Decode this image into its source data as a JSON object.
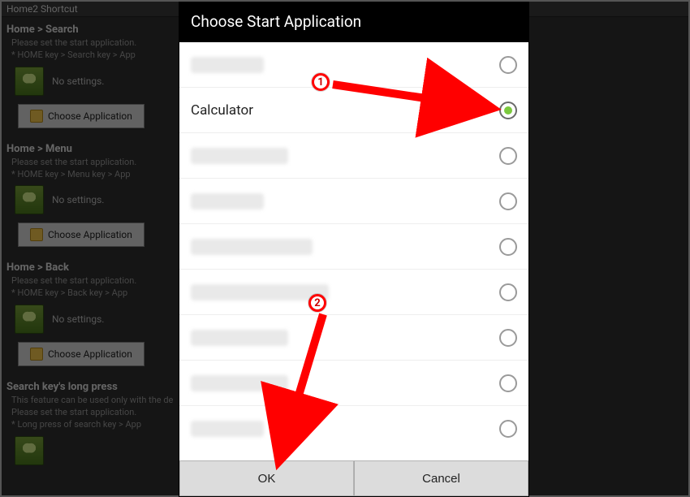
{
  "app": {
    "title": "Home2 Shortcut"
  },
  "background": {
    "sections": [
      {
        "title": "Home > Search",
        "desc1": "Please set the start application.",
        "desc2": "* HOME key > Search key > App",
        "no_settings": "No settings.",
        "button": "Choose Application"
      },
      {
        "title": "Home > Menu",
        "desc1": "Please set the start application.",
        "desc2": "* HOME key > Menu key > App",
        "no_settings": "No settings.",
        "button": "Choose Application"
      },
      {
        "title": "Home > Back",
        "desc1": "Please set the start application.",
        "desc2": "* HOME key > Back key > App",
        "no_settings": "No settings.",
        "button": "Choose Application"
      },
      {
        "title": "Search key's long press",
        "desc1": "This feature can be used only with the de",
        "desc2": "Please set the start application.",
        "desc3": "* Long press of search key > App",
        "no_settings": "",
        "button": ""
      }
    ]
  },
  "dialog": {
    "title": "Choose Start Application",
    "options": [
      {
        "label": "",
        "selected": false,
        "blurred": true,
        "w": "w1"
      },
      {
        "label": "Calculator",
        "selected": true,
        "blurred": false
      },
      {
        "label": "",
        "selected": false,
        "blurred": true,
        "w": "w2"
      },
      {
        "label": "",
        "selected": false,
        "blurred": true,
        "w": "w1"
      },
      {
        "label": "",
        "selected": false,
        "blurred": true,
        "w": "w3"
      },
      {
        "label": "",
        "selected": false,
        "blurred": true,
        "w": "w4"
      },
      {
        "label": "",
        "selected": false,
        "blurred": true,
        "w": "w2"
      },
      {
        "label": "",
        "selected": false,
        "blurred": true,
        "w": "w2"
      },
      {
        "label": "",
        "selected": false,
        "blurred": true,
        "w": "w1"
      }
    ],
    "ok": "OK",
    "cancel": "Cancel"
  },
  "annotations": {
    "marker1": "1",
    "marker2": "2"
  }
}
